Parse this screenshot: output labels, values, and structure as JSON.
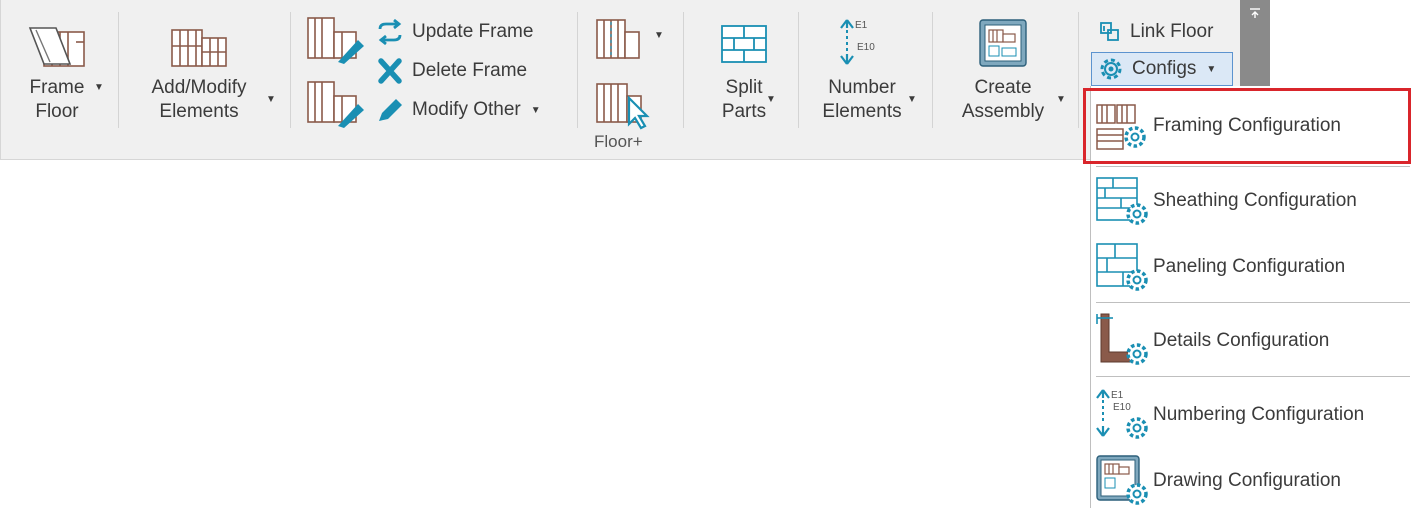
{
  "colors": {
    "teal": "#1a8fb3",
    "brown": "#8a5a4a",
    "highlight_red": "#d9252b",
    "ribbon_bg": "#f0f0f0"
  },
  "ribbon": {
    "frame_floor": {
      "line1": "Frame",
      "line2": "Floor",
      "icon": "frame-floor-icon"
    },
    "add_modify": {
      "line1": "Add/Modify",
      "line2": "Elements",
      "icon": "add-modify-icon"
    },
    "update_frame": "Update Frame",
    "delete_frame": "Delete Frame",
    "modify_other": "Modify Other",
    "group_label": "Floor+",
    "split_parts": {
      "line1": "Split",
      "line2": "Parts"
    },
    "number_elements": {
      "line1": "Number",
      "line2": "Elements",
      "tag_top": "E1",
      "tag_bottom": "E10"
    },
    "create_assembly": {
      "line1": "Create",
      "line2": "Assembly"
    },
    "link_floor": "Link Floor",
    "configs": "Configs"
  },
  "menu": {
    "items": [
      {
        "label": "Framing Configuration",
        "icon": "framing-config-icon",
        "highlighted": true
      },
      {
        "label": "Sheathing Configuration",
        "icon": "sheathing-config-icon"
      },
      {
        "label": "Paneling Configuration",
        "icon": "paneling-config-icon"
      },
      {
        "label": "Details Configuration",
        "icon": "details-config-icon"
      },
      {
        "label": "Numbering Configuration",
        "icon": "numbering-config-icon",
        "tag_top": "E1",
        "tag_bottom": "E10"
      },
      {
        "label": "Drawing Configuration",
        "icon": "drawing-config-icon"
      }
    ]
  }
}
